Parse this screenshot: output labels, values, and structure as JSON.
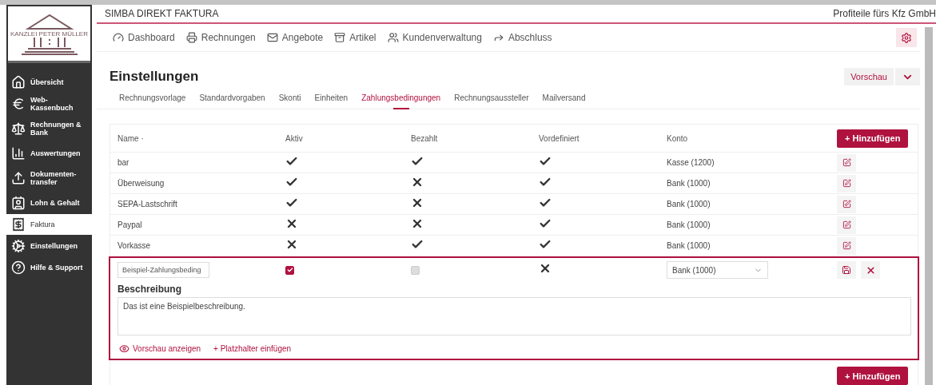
{
  "logo": {
    "text": "KANZLEI PETER MÜLLER"
  },
  "sidebar": {
    "items": [
      {
        "label": "Übersicht",
        "selected": false
      },
      {
        "label": "Web-Kassenbuch",
        "selected": false
      },
      {
        "label": "Rechnungen & Bank",
        "selected": false
      },
      {
        "label": "Auswertungen",
        "selected": false
      },
      {
        "label": "Dokumenten-transfer",
        "selected": false
      },
      {
        "label": "Lohn & Gehalt",
        "selected": false
      },
      {
        "label": "Faktura",
        "selected": true
      },
      {
        "label": "Einstellungen",
        "selected": false
      },
      {
        "label": "Hilfe & Support",
        "selected": false
      }
    ]
  },
  "header": {
    "title": "SIMBA DIREKT FAKTURA",
    "company": "Profiteile fürs Kfz GmbH"
  },
  "nav": [
    "Dashboard",
    "Rechnungen",
    "Angebote",
    "Artikel",
    "Kundenverwaltung",
    "Abschluss"
  ],
  "page": {
    "title": "Einstellungen",
    "preview_button": "Vorschau"
  },
  "tabs": [
    {
      "label": "Rechnungsvorlage",
      "selected": false
    },
    {
      "label": "Standardvorgaben",
      "selected": false
    },
    {
      "label": "Skonti",
      "selected": false
    },
    {
      "label": "Einheiten",
      "selected": false
    },
    {
      "label": "Zahlungsbedingungen",
      "selected": true
    },
    {
      "label": "Rechnungsaussteller",
      "selected": false
    },
    {
      "label": "Mailversand",
      "selected": false
    }
  ],
  "table": {
    "columns": [
      "Name ·",
      "Aktiv",
      "Bezahlt",
      "Vordefiniert",
      "Konto"
    ],
    "add_button": "+ Hinzufügen",
    "rows": [
      {
        "name": "bar",
        "aktiv": true,
        "bezahlt": true,
        "vordefiniert": true,
        "konto": "Kasse (1200)"
      },
      {
        "name": "Überweisung",
        "aktiv": true,
        "bezahlt": false,
        "vordefiniert": true,
        "konto": "Bank (1000)"
      },
      {
        "name": "SEPA-Lastschrift",
        "aktiv": true,
        "bezahlt": false,
        "vordefiniert": true,
        "konto": "Bank (1000)"
      },
      {
        "name": "Paypal",
        "aktiv": false,
        "bezahlt": false,
        "vordefiniert": true,
        "konto": "Bank (1000)"
      },
      {
        "name": "Vorkasse",
        "aktiv": false,
        "bezahlt": true,
        "vordefiniert": true,
        "konto": "Bank (1000)"
      }
    ],
    "edit_row": {
      "name": "Beispiel-Zahlungsbeding",
      "aktiv": {
        "checked": true
      },
      "bezahlt": {
        "checked": false,
        "disabled": true
      },
      "vordefiniert": false,
      "konto": "Bank (1000)",
      "description_label": "Beschreibung",
      "description": "Das ist eine Beispielbeschreibung.",
      "preview_link": "Vorschau anzeigen",
      "placeholder_link": "+ Platzhalter einfügen"
    },
    "bottom_add_button": "+ Hinzufügen"
  }
}
